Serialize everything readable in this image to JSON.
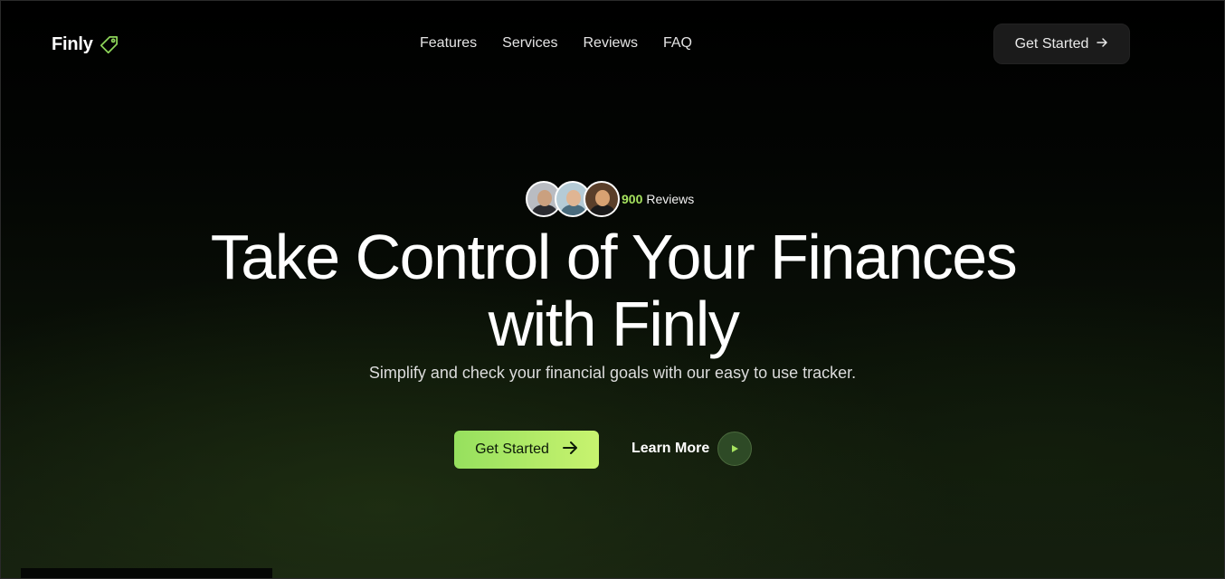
{
  "nav": {
    "logo_text": "Finly",
    "logo_icon": "tag-icon",
    "menu": [
      {
        "label": "Features"
      },
      {
        "label": "Services"
      },
      {
        "label": "Reviews"
      },
      {
        "label": "FAQ"
      }
    ],
    "cta_label": "Get Started",
    "cta_icon": "arrow-right-icon"
  },
  "reviews": {
    "count": "900",
    "label": "Reviews",
    "avatars": [
      "avatar",
      "avatar",
      "avatar"
    ]
  },
  "hero": {
    "headline_line1": "Take Control of Your Finances",
    "headline_line2": "with Finly",
    "subtitle": "Simplify and check your financial goals with our easy to use tracker.",
    "primary_cta_label": "Get Started",
    "secondary_cta_label": "Learn More",
    "secondary_cta_icon": "play-icon"
  },
  "colors": {
    "accent": "#a6e35f",
    "accent_gradient_start": "#96e05e",
    "accent_gradient_end": "#c8f36f",
    "background": "#000000",
    "nav_button_bg": "#1b1b1b"
  }
}
